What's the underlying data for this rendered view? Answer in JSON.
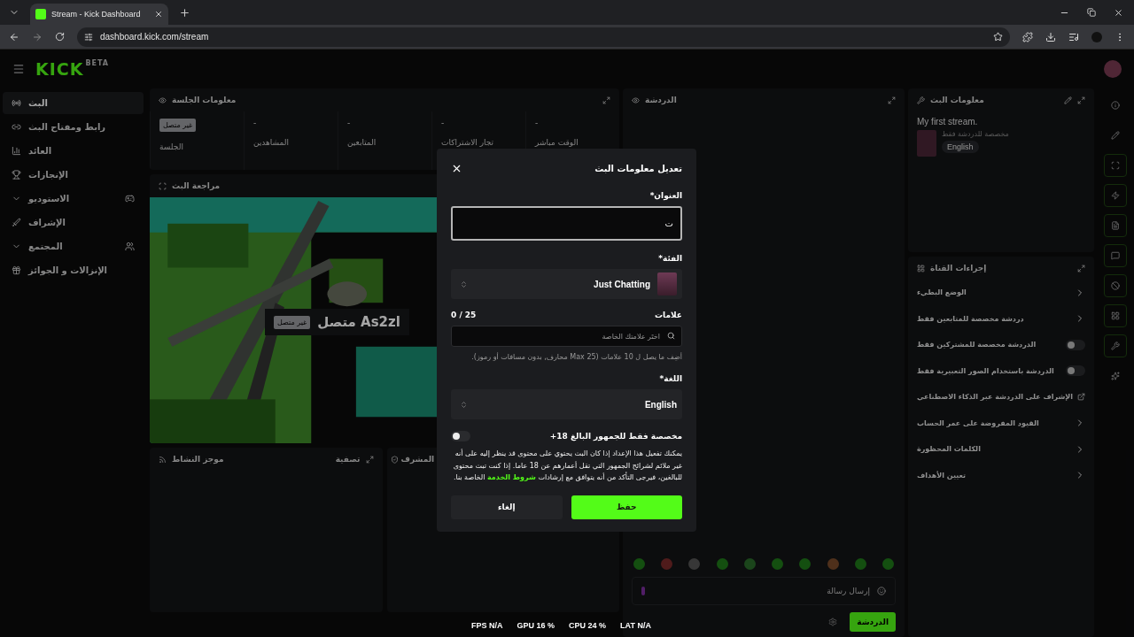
{
  "browser": {
    "tab_title": "Stream - Kick Dashboard",
    "url": "dashboard.kick.com/stream"
  },
  "header": {
    "logo": "KICK",
    "logo_badge": "BETA"
  },
  "sidebar": {
    "items": [
      {
        "label": "البث",
        "selected": true,
        "kind": "link"
      },
      {
        "label": "رابط ومفتاح البث",
        "selected": false,
        "kind": "link"
      },
      {
        "label": "العائد",
        "selected": false,
        "kind": "link"
      },
      {
        "label": "الإنجازات",
        "selected": false,
        "kind": "link"
      },
      {
        "label": "الاستوديو",
        "selected": false,
        "kind": "group"
      },
      {
        "label": "الإشراف",
        "selected": false,
        "kind": "link"
      },
      {
        "label": "المجتمع",
        "selected": false,
        "kind": "group"
      },
      {
        "label": "الإنزالات و الجوائز",
        "selected": false,
        "kind": "link"
      }
    ]
  },
  "session_panel": {
    "title": "معلومات الجلسة",
    "stats": [
      {
        "kind": "number",
        "value": "-",
        "label": "الوقت مباشر"
      },
      {
        "kind": "number",
        "value": "-",
        "label": "تجار الاشتراكات"
      },
      {
        "kind": "number",
        "value": "-",
        "label": "المتابعين"
      },
      {
        "kind": "number",
        "value": "-",
        "label": "المشاهدين"
      },
      {
        "kind": "badge",
        "value": "غير متصل",
        "label": "الجلسة"
      }
    ]
  },
  "preview_panel": {
    "title": "مراجعة البث",
    "channel": "As2zl متصل",
    "status_badge": "غير متصل"
  },
  "activity_panel": {
    "title": "موجز النشاط",
    "filter": "تصفية"
  },
  "moderator_panel": {
    "title": "المشرف"
  },
  "chat_panel": {
    "title": "الدردشة",
    "placeholder": "إرسال رسالة",
    "send_button": "الدردشة"
  },
  "stream_info": {
    "title": "معلومات البث",
    "stream_title": "My first stream.",
    "category": "مخصصة للدردشة فقط",
    "language": "English"
  },
  "channel_actions": {
    "title": "إجراءات القناة",
    "items": [
      {
        "label": "الوضع البطيء",
        "kind": "link"
      },
      {
        "label": "دردشة مخصصة للمتابعين فقط",
        "kind": "link"
      },
      {
        "label": "الدردشة مخصصة للمشتركين فقط",
        "kind": "toggle",
        "on": false
      },
      {
        "label": "الدردشة باستخدام الصور التعبيرية فقط",
        "kind": "toggle",
        "on": false
      },
      {
        "label": "الإشراف على الدردشة عبر الذكاء الاصطناعي",
        "kind": "external"
      },
      {
        "label": "القيود المفروضة على عمر الحساب",
        "kind": "link"
      },
      {
        "label": "الكلمات المحظورة",
        "kind": "link"
      },
      {
        "label": "تعيين الأهداف",
        "kind": "link"
      }
    ]
  },
  "modal": {
    "title": "تعديل معلومات البث",
    "title_label": "العنوان*",
    "title_value": "ت",
    "category_label": "الفئة*",
    "category_value": "Just Chatting",
    "tags_label": "علامات",
    "tags_count": "0 / 25",
    "tags_placeholder": "اختَر علامتك الخاصة",
    "tags_hint": "أضِف ما يصل ل 10 علامات (Max 25 محارف, بدون مسافات أو رموز).",
    "language_label": "اللغة*",
    "language_value": "English",
    "adult_label": "مخصصة فقط للجمهور البالغ 18+",
    "adult_on": false,
    "adult_text": "يمكنك تفعيل هذا الإعداد إذا كان البث يحتوي على محتوى قد ينظر إليه على أنه غير ملائم لشرائح الجمهور التي تقل أعمارهم عن 18 عاما. إذا كنت تبث محتوى للبالغين، فيرجى التأكد من أنه يتوافق مع إرشادات **شروط الخدمة** الخاصة بنا.",
    "cancel": "إلغاء",
    "save": "حفظ"
  },
  "status_bar": [
    "LAT N/A",
    "CPU 24 %",
    "GPU 16 %",
    "FPS N/A"
  ]
}
